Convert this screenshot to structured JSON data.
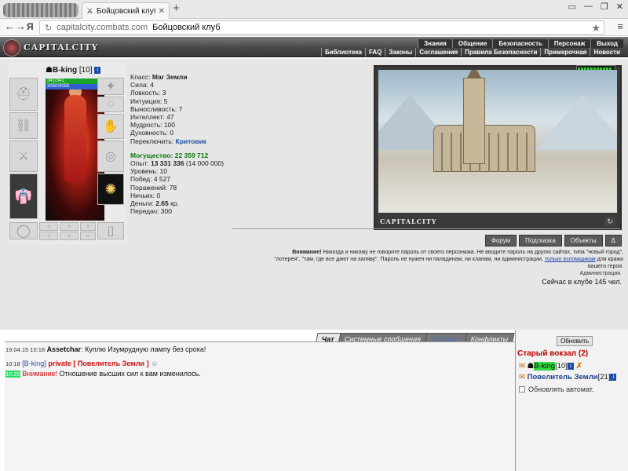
{
  "browser": {
    "tab_title": "Бойцовский клуб",
    "tab_close": "✕",
    "new_tab": "+",
    "window_buttons": [
      "▭",
      "—",
      "❐",
      "✕"
    ],
    "nav_back": "←",
    "nav_forward": "→",
    "nav_yandex": "Я",
    "url_host": "capitalcity.combats.com",
    "url_page": "Бойцовский клуб",
    "star": "★",
    "menu": "≡"
  },
  "header": {
    "logo_text": "CAPITALCITY",
    "top_nav": [
      "Знания",
      "Общение",
      "Безопасность",
      "Персонаж",
      "Выход"
    ],
    "sub_nav": [
      "Библиотека",
      "FAQ",
      "Законы",
      "Соглашения",
      "Правила Безопасности",
      "Примерочная",
      "Новости"
    ]
  },
  "character": {
    "prefix": "☗",
    "nick": "B-king",
    "level": "[10]",
    "info": "i",
    "hp": "341/341",
    "mp": "3050/3050"
  },
  "stats": {
    "class_label": "Класс:",
    "class_value": "Маг Земли",
    "strength": "Сила: 4",
    "agility": "Ловкость: 3",
    "intuition": "Интуиция: 5",
    "endurance": "Выносливость: 7",
    "intellect": "Интеллект: 47",
    "wisdom": "Мудрость: 100",
    "spirit": "Духовность: 0",
    "switch_label": "Переключить:",
    "switch_value": "Критовик",
    "might_label": "Могущество:",
    "might_value": "22 359 712",
    "exp_label": "Опыт:",
    "exp_value": "13 331 336",
    "exp_next": "(14 000 000)",
    "level": "Уровень: 10",
    "wins": "Побед: 4 527",
    "losses": "Поражений: 78",
    "draws": "Ничьих: 0",
    "money_label": "Деньги:",
    "money_value": "2.65",
    "money_unit": "кр.",
    "transfers": "Передач: 300"
  },
  "scene": {
    "label": "CAPITALCITY",
    "reload": "↻"
  },
  "buttons": [
    "Форум",
    "Подсказка",
    "Объекты",
    "Δ"
  ],
  "warning": {
    "title": "Внимание!",
    "text1": "Никогда и никому не говорите пароль от своего персонажа. Не вводите пароль на других сайтах, типа \"новый город\",",
    "text2": "\"лотерея\", \"там, где все дают на халяву\". Пароль не нужен ни паладинам, ни кланам, ни администрации,",
    "link": "только взломщикам",
    "text3": "для кражи",
    "text4": "вашего героя.",
    "admin": "Администрация.",
    "online": "Сейчас в клубе 145 чел."
  },
  "chat": {
    "tabs": [
      "Чат",
      "Системные сообщения",
      "Торговля",
      "Конфликты"
    ],
    "messages": [
      {
        "time": "19.04.15 10:18",
        "sender": "Assetchar",
        "text": ": Куплю Изумрудную лампу без срока!"
      },
      {
        "time": "10:18",
        "sender": "[B-king]",
        "tag": "private [ Повелитель Земли ]"
      },
      {
        "time": "10:20",
        "prefix": "Внимание!",
        "text": "Отношение высших сил к вам изменилось."
      }
    ]
  },
  "sidebar": {
    "refresh": "Обновить",
    "room": "Старый вокзал (2)",
    "users": [
      {
        "name": "B-king",
        "level": "[10]",
        "info": "i",
        "x": "✗"
      },
      {
        "name": "Повелитель Земли",
        "level": "[21]",
        "info": "i"
      }
    ],
    "auto_refresh": "Обновлять автомат."
  }
}
